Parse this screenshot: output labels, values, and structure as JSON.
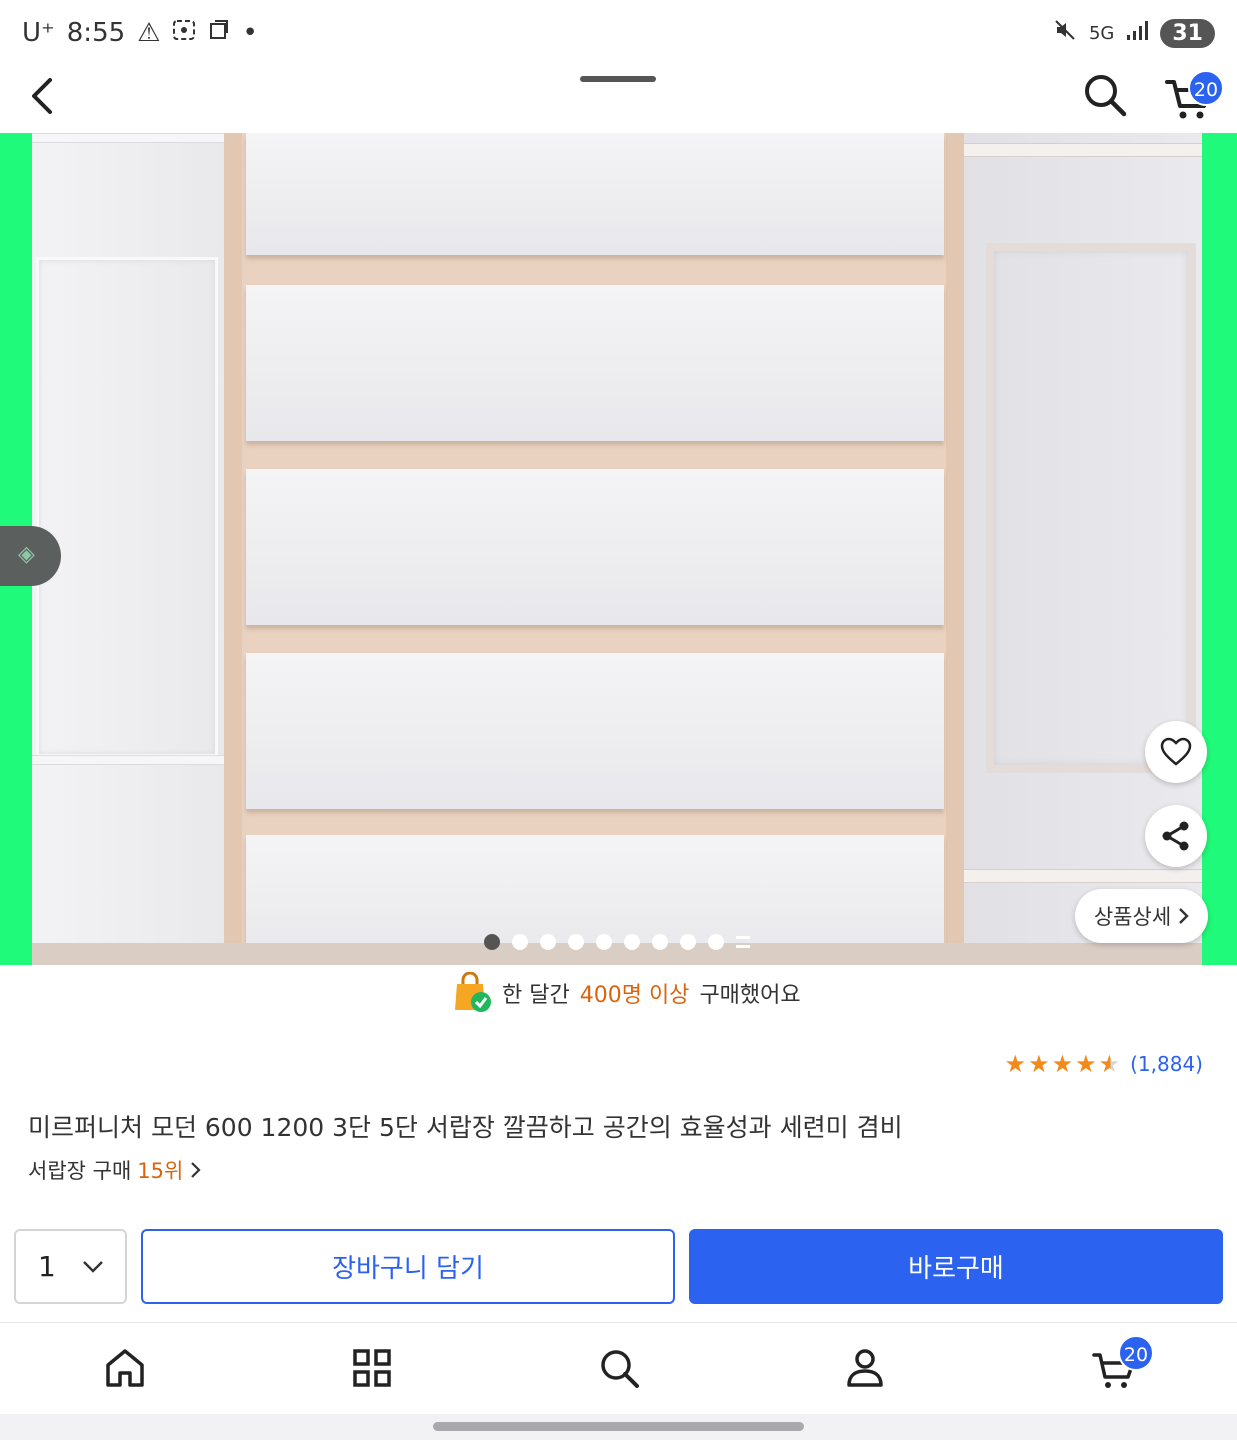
{
  "status_bar": {
    "carrier": "U⁺",
    "time": "8:55",
    "network": "5G",
    "battery": "31"
  },
  "header": {
    "cart_badge": "20"
  },
  "hero": {
    "background_color": "#1ffa7a",
    "image_total": 9,
    "image_index": 1,
    "detail_button": "상품상세"
  },
  "purchase_note": {
    "prefix": "한 달간",
    "highlight": "400명 이상",
    "suffix": "구매했어요"
  },
  "rating": {
    "stars": 4.5,
    "count": "(1,884)"
  },
  "product": {
    "title": "미르퍼니처 모던 600 1200 3단 5단 서랍장 깔끔하고 공간의 효율성과 세련미 겸비",
    "rank_prefix": "서랍장 구매",
    "rank_value": "15위"
  },
  "actions": {
    "quantity": "1",
    "add_to_cart": "장바구니 담기",
    "buy_now": "바로구매"
  },
  "bottom_nav": {
    "cart_badge": "20",
    "items": [
      "home-icon",
      "category-icon",
      "search-icon",
      "profile-icon",
      "cart-icon"
    ]
  },
  "colors": {
    "accent": "#2b62f0",
    "highlight": "#d8650e",
    "star": "#f18a1a"
  }
}
